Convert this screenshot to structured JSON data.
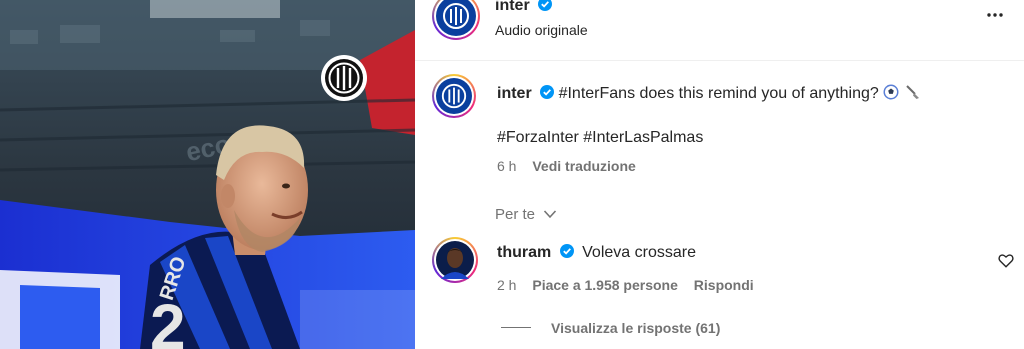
{
  "header": {
    "username": "inter",
    "subtitle": "Audio originale",
    "more_icon": "more-horizontal-icon"
  },
  "caption": {
    "username": "inter",
    "hashtag_lead": "#InterFans",
    "text": " does this remind you of anything? ",
    "emojis": [
      "soccer-ball-icon",
      "broom-icon"
    ],
    "hashtags": "#ForzaInter #InterLasPalmas",
    "time": "6 h",
    "translate": "Vedi traduzione"
  },
  "for_you_label": "Per te",
  "comment": {
    "username": "thuram",
    "text": "Voleva crossare",
    "time": "2 h",
    "likes": "Piace a 1.958 persone",
    "reply": "Rispondi",
    "view_replies": "Visualizza le risposte (61)"
  },
  "colors": {
    "accent": "#0095f6",
    "inter_blue": "#0a3f9e",
    "hashtag": "#00376b",
    "muted": "#737373"
  }
}
